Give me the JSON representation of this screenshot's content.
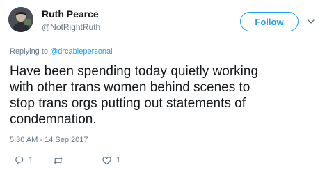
{
  "user": {
    "display_name": "Ruth Pearce",
    "handle": "@NotRightRuth"
  },
  "follow_label": "Follow",
  "replying": {
    "prefix": "Replying to ",
    "mention": "@drcablepersonal"
  },
  "tweet_text": "Have been spending today quietly working\nwith other trans women behind scenes to\nstop trans orgs putting out statements of\ncondemnation.",
  "timestamp": "5:30 AM - 14 Sep 2017",
  "actions": {
    "reply_count": "1",
    "retweet_count": "",
    "like_count": "1"
  },
  "colors": {
    "accent": "#1da1f2",
    "muted": "#657786",
    "text": "#14171a"
  },
  "icons": {
    "reply": "reply-icon",
    "retweet": "retweet-icon",
    "like": "heart-icon",
    "caret": "chevron-down-icon"
  }
}
